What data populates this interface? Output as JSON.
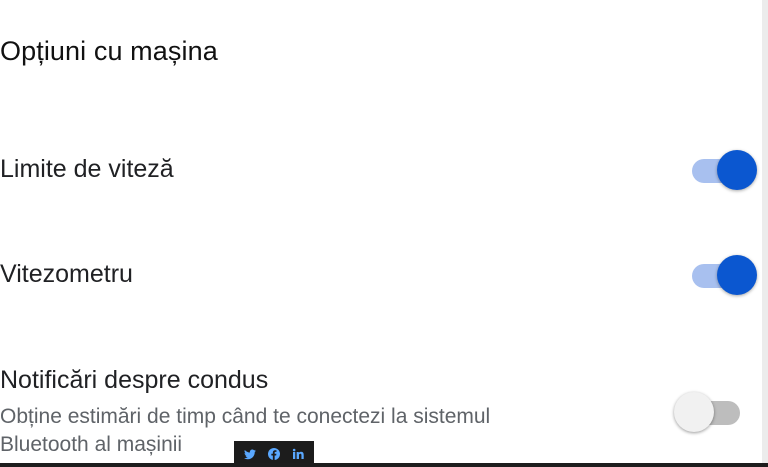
{
  "section": {
    "title": "Opțiuni cu mașina"
  },
  "settings": [
    {
      "title": "Limite de viteză",
      "enabled": true
    },
    {
      "title": "Vitezometru",
      "enabled": true
    },
    {
      "title": "Notificări despre condus",
      "subtitle_line1": "Obține estimări de timp când te conectezi la sistemul",
      "subtitle_line2": "Bluetooth al mașinii",
      "enabled": false
    }
  ],
  "share_bar": {
    "icons": [
      "twitter-icon",
      "facebook-icon",
      "linkedin-icon"
    ]
  },
  "colors": {
    "toggle_on_thumb": "#0b57d0",
    "toggle_on_track": "#a8c0ef",
    "toggle_off_thumb": "#f1f1f1",
    "toggle_off_track": "#bdbdbd",
    "share_bar_bg": "#1c1c1c",
    "share_icon": "#5aa8ff"
  }
}
